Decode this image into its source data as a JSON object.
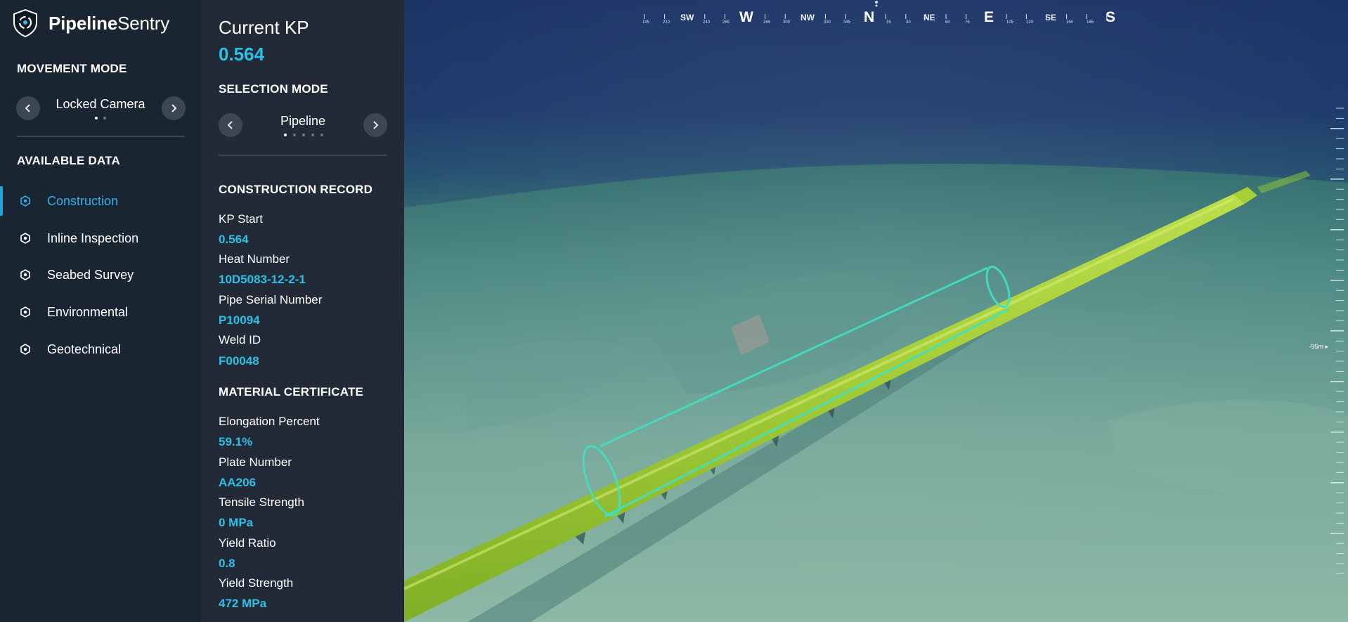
{
  "app": {
    "name_bold": "Pipeline",
    "name_regular": "Sentry"
  },
  "movement_mode": {
    "heading": "MOVEMENT MODE",
    "value": "Locked Camera",
    "page_count": 2,
    "active_index": 0
  },
  "available_data": {
    "heading": "AVAILABLE DATA",
    "items": [
      {
        "label": "Construction",
        "active": true
      },
      {
        "label": "Inline Inspection",
        "active": false
      },
      {
        "label": "Seabed Survey",
        "active": false
      },
      {
        "label": "Environmental",
        "active": false
      },
      {
        "label": "Geotechnical",
        "active": false
      }
    ]
  },
  "current_kp": {
    "title": "Current KP",
    "value": "0.564"
  },
  "selection_mode": {
    "heading": "SELECTION MODE",
    "value": "Pipeline",
    "page_count": 5,
    "active_index": 0
  },
  "construction_record": {
    "heading": "CONSTRUCTION RECORD",
    "fields": [
      {
        "label": "KP Start",
        "value": "0.564"
      },
      {
        "label": "Heat Number",
        "value": "10D5083-12-2-1"
      },
      {
        "label": "Pipe Serial Number",
        "value": "P10094"
      },
      {
        "label": "Weld ID",
        "value": "F00048"
      }
    ]
  },
  "material_certificate": {
    "heading": "MATERIAL CERTIFICATE",
    "fields": [
      {
        "label": "Elongation Percent",
        "value": "59.1%"
      },
      {
        "label": "Plate Number",
        "value": "AA206"
      },
      {
        "label": "Tensile Strength",
        "value": "0 MPa"
      },
      {
        "label": "Yield Ratio",
        "value": "0.8"
      },
      {
        "label": "Yield Strength",
        "value": "472 MPa"
      }
    ]
  },
  "compass": {
    "cardinals": [
      "SW",
      "W",
      "NW",
      "N",
      "NE",
      "E",
      "SE",
      "S"
    ],
    "degrees": [
      "195",
      "210",
      "240",
      "255",
      "285",
      "300",
      "330",
      "345",
      "15",
      "30",
      "60",
      "75",
      "105",
      "120",
      "150",
      "165"
    ]
  },
  "depth_gauge": {
    "label": "-95m ▸"
  },
  "colors": {
    "accent": "#2bc1e6",
    "active_nav": "#29b2ec",
    "sidebar_bg": "#1a2532",
    "panel_bg": "#212a36",
    "pipe": "#a6cf3a",
    "selection_outline": "#3fe0c4",
    "water_deep": "#1b3466",
    "seabed": "#6fa59a"
  },
  "icons": {
    "logo": "shield-logo-icon",
    "prev": "chevron-left-icon",
    "next": "chevron-right-icon",
    "data_item": "hexagon-target-icon"
  }
}
